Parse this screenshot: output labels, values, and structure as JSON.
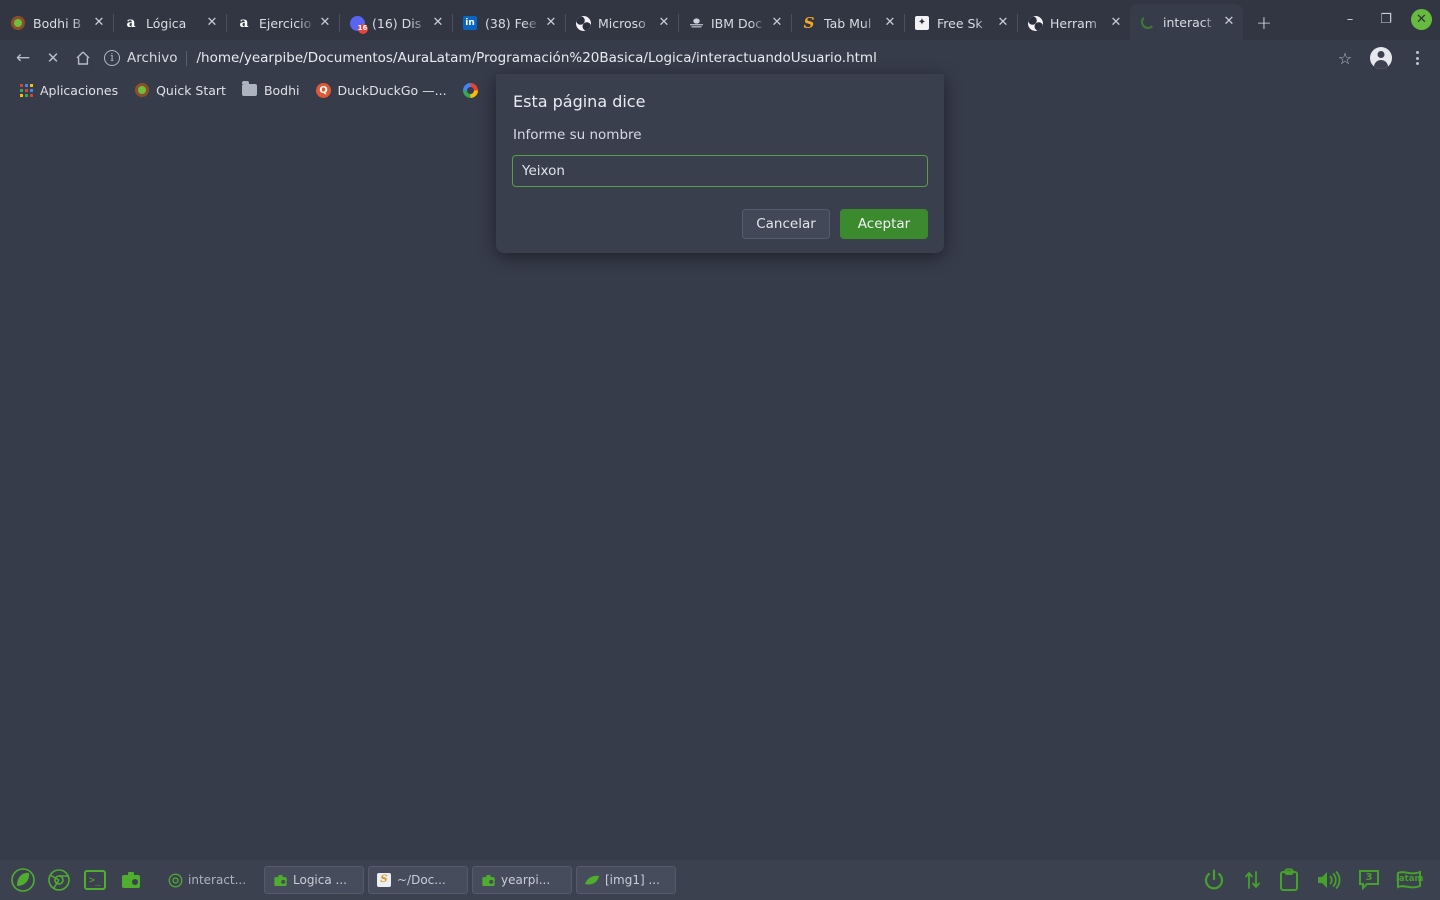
{
  "window": {
    "controls": {
      "minimize": "–",
      "maximize": "❐",
      "close": "✕"
    }
  },
  "tabstrip": {
    "new_tab_label": "+",
    "close_glyph": "✕",
    "tabs": [
      {
        "title": "Bodhi B",
        "icon": "bodhi-icon",
        "active": false
      },
      {
        "title": "Lógica ",
        "icon": "amazon-icon",
        "active": false
      },
      {
        "title": "Ejercicio",
        "icon": "amazon-icon",
        "active": false
      },
      {
        "title": "(16) Dis",
        "icon": "discord-icon",
        "badge": "16",
        "active": false
      },
      {
        "title": "(38) Fee",
        "icon": "linkedin-icon",
        "active": false
      },
      {
        "title": "Microso",
        "icon": "globe-icon",
        "active": false
      },
      {
        "title": "IBM Doc",
        "icon": "ibm-icon",
        "active": false
      },
      {
        "title": "Tab Mul",
        "icon": "sublime-icon",
        "active": false
      },
      {
        "title": "Free Sk",
        "icon": "freeskills-icon",
        "active": false
      },
      {
        "title": "Herram",
        "icon": "globe-icon",
        "active": false
      },
      {
        "title": "interact",
        "icon": "loading-spinner-icon",
        "active": true
      }
    ]
  },
  "toolbar": {
    "back_glyph": "←",
    "forward_glyph": "→",
    "stop_glyph": "✕",
    "home_glyph": "⌂",
    "scheme_label": "Archivo",
    "url": "/home/yearpibe/Documentos/AuraLatam/Programación%20Basica/Logica/interactuandoUsuario.html",
    "bookmark_glyph": "☆"
  },
  "bookmarks": {
    "items": [
      {
        "label": "Aplicaciones",
        "icon": "apps-grid-icon"
      },
      {
        "label": "Quick Start",
        "icon": "bodhi-icon"
      },
      {
        "label": "Bodhi",
        "icon": "folder-icon"
      },
      {
        "label": "DuckDuckGo —...",
        "icon": "duckduckgo-icon"
      },
      {
        "label": "",
        "icon": "google-icon"
      }
    ]
  },
  "dialog": {
    "title": "Esta página dice",
    "message": "Informe su nombre",
    "input_value": "Yeixon",
    "input_placeholder": "",
    "cancel_label": "Cancelar",
    "accept_label": "Aceptar",
    "accent_color": "#3c8a2e",
    "border_color": "#5a9c4a"
  },
  "taskbar": {
    "launchers": [
      {
        "name": "bodhi-menu-icon"
      },
      {
        "name": "chrome-icon"
      },
      {
        "name": "terminal-icon"
      },
      {
        "name": "files-icon"
      }
    ],
    "windows": [
      {
        "label": "interact...",
        "icon": "chrome-icon",
        "raised": false
      },
      {
        "label": "Logica ...",
        "icon": "files-icon",
        "raised": true
      },
      {
        "label": "~/Doc...",
        "icon": "sublime-icon",
        "raised": true
      },
      {
        "label": "yearpi...",
        "icon": "files-icon",
        "raised": true
      },
      {
        "label": "[img1] ...",
        "icon": "leafpad-icon",
        "raised": true
      }
    ],
    "tray": [
      {
        "name": "power-icon"
      },
      {
        "name": "network-icon"
      },
      {
        "name": "clipboard-icon"
      },
      {
        "name": "volume-icon"
      },
      {
        "name": "workspace-icon",
        "label": "3"
      },
      {
        "name": "keyboard-layout-icon",
        "label": "latam"
      }
    ]
  }
}
